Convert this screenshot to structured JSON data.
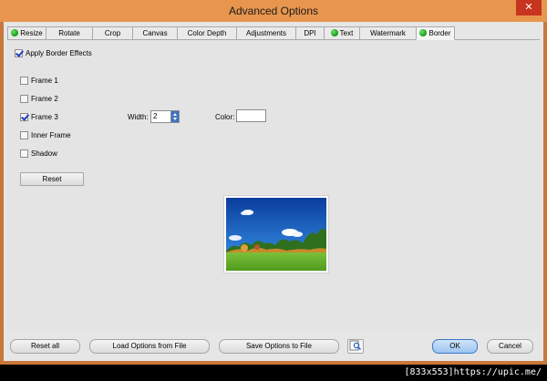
{
  "window": {
    "title": "Advanced Options",
    "close_glyph": "✕",
    "accent_color": "#e8964e"
  },
  "tabs": [
    {
      "label": "Resize",
      "indicator": true
    },
    {
      "label": "Rotate",
      "indicator": false
    },
    {
      "label": "Crop",
      "indicator": false
    },
    {
      "label": "Canvas",
      "indicator": false
    },
    {
      "label": "Color Depth",
      "indicator": false
    },
    {
      "label": "Adjustments",
      "indicator": false
    },
    {
      "label": "DPI",
      "indicator": false
    },
    {
      "label": "Text",
      "indicator": true
    },
    {
      "label": "Watermark",
      "indicator": false
    },
    {
      "label": "Border",
      "indicator": true,
      "active": true
    }
  ],
  "border": {
    "apply_label": "Apply Border Effects",
    "apply_checked": true,
    "options": [
      {
        "label": "Frame 1",
        "checked": false
      },
      {
        "label": "Frame 2",
        "checked": false
      },
      {
        "label": "Frame 3",
        "checked": true
      },
      {
        "label": "Inner Frame",
        "checked": false
      },
      {
        "label": "Shadow",
        "checked": false
      }
    ],
    "width_label": "Width:",
    "width_value": "2",
    "color_label": "Color:",
    "color_value": "#ffffff",
    "reset_label": "Reset"
  },
  "preview": {
    "icon": "landscape-thumbnail"
  },
  "footer_buttons": {
    "reset_all": "Reset all",
    "load": "Load Options from File",
    "save": "Save Options to File",
    "preview_icon": "magnifier-icon",
    "ok": "OK",
    "cancel": "Cancel"
  },
  "watermark_text": "[833x553]https://upic.me/"
}
